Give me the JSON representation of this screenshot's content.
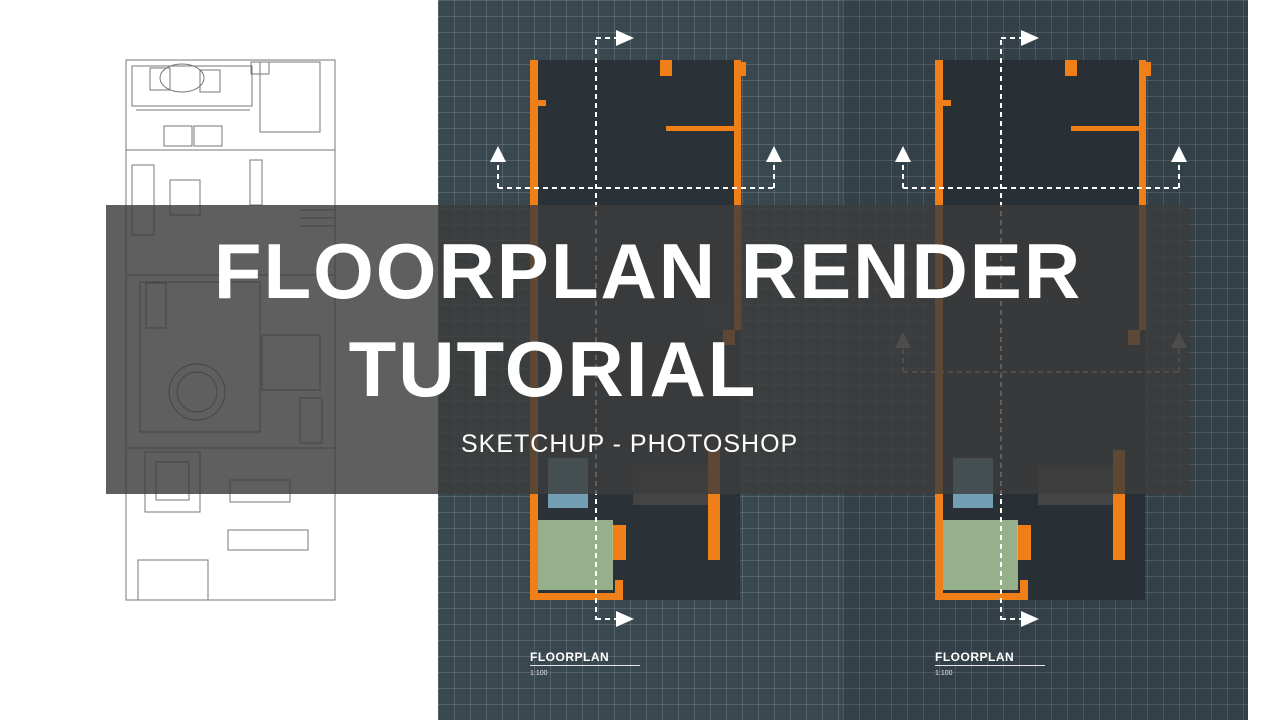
{
  "title": {
    "line1": "FLOORPLAN RENDER",
    "line2": "TUTORIAL"
  },
  "subtitle": "SKETCHUP - PHOTOSHOP",
  "plans": [
    {
      "label": "FLOORPLAN",
      "scale": "1:100"
    },
    {
      "label": "FLOORPLAN",
      "scale": "1:100"
    }
  ],
  "colors": {
    "wall_accent": "#f07f17",
    "grid_background": "#39474f",
    "banner": "#3c3c3c",
    "pool": "#7fb3c9",
    "lawn": "#a9c79a"
  }
}
